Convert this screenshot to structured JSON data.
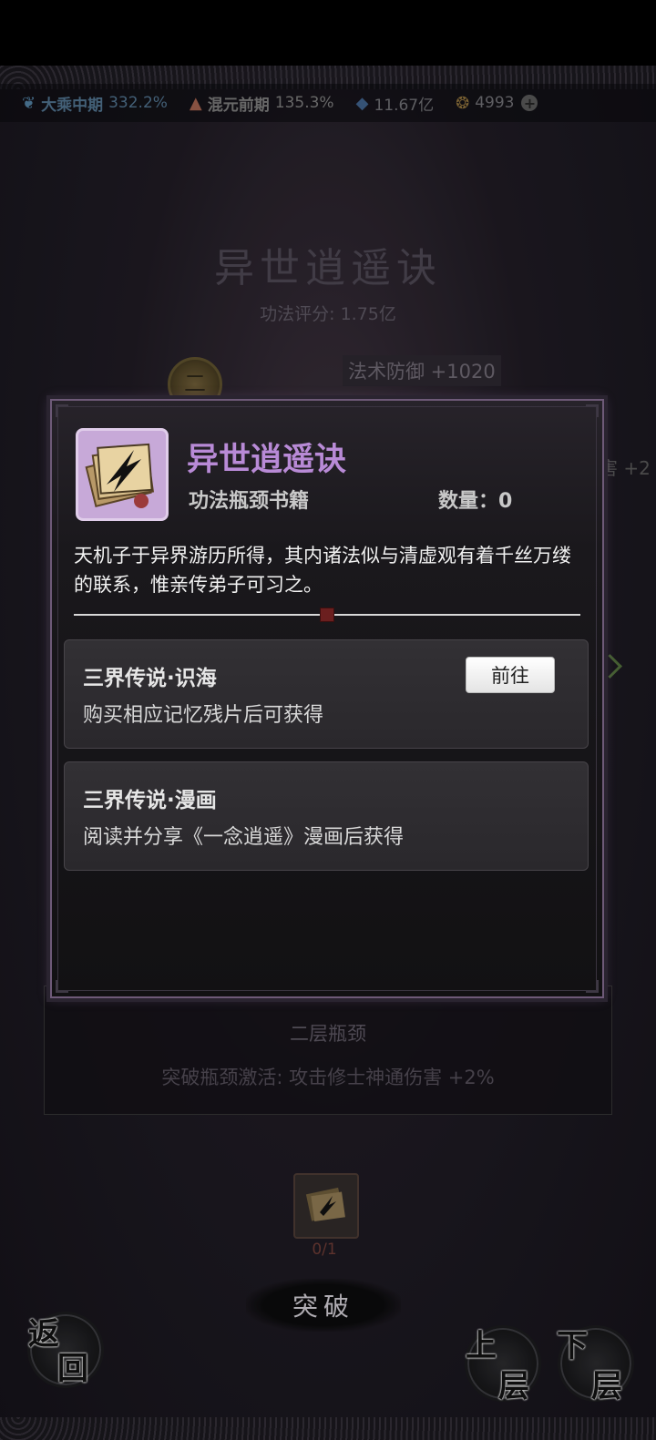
{
  "topbar": {
    "realm1": {
      "icon": "wing-icon",
      "label": "大乘中期",
      "value": "332.2%"
    },
    "realm2": {
      "icon": "mountain-icon",
      "label": "混元前期",
      "value": "135.3%"
    },
    "spirit_stones": {
      "icon": "crystal-icon",
      "value": "11.67亿"
    },
    "jade": {
      "icon": "coin-icon",
      "value": "4993"
    }
  },
  "background": {
    "technique_title": "异世逍遥诀",
    "technique_score": "功法评分: 1.75亿",
    "node_label": "二",
    "bonus_label": "法术防御 +1020",
    "bonus_label2": "害 +2",
    "layer_title": "二层瓶颈",
    "layer_desc": "突破瓶颈激活: 攻击修士神通伤害 +2%",
    "requirement_count": "0/1",
    "breakthrough_label": "突破",
    "back_label_1": "返",
    "back_label_2": "回",
    "up_label_1": "上",
    "up_label_2": "层",
    "down_label_1": "下",
    "down_label_2": "层"
  },
  "modal": {
    "item_name": "异世逍遥诀",
    "item_type": "功法瓶颈书籍",
    "quantity": "数量：0",
    "description": "天机子于异界游历所得，其内诸法似与清虚观有着千丝万缕的联系，惟亲传弟子可习之。",
    "sources": [
      {
        "title": "三界传说·识海",
        "desc": "购买相应记忆残片后可获得",
        "button": "前往"
      },
      {
        "title": "三界传说·漫画",
        "desc": "阅读并分享《一念逍遥》漫画后获得"
      }
    ]
  }
}
